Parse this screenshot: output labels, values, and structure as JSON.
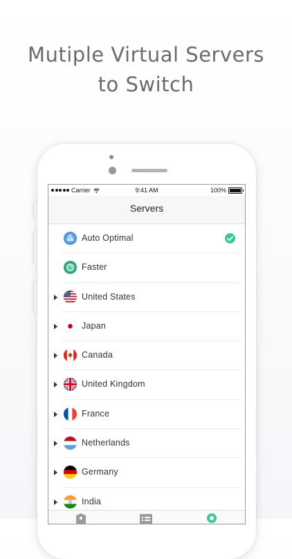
{
  "headline": {
    "line1": "Mutiple Virtual Servers",
    "line2": "to Switch"
  },
  "status_bar": {
    "carrier": "Carrier",
    "time": "9:41 AM",
    "battery": "100%"
  },
  "nav": {
    "title": "Servers"
  },
  "servers": [
    {
      "label": "Auto Optimal",
      "icon": "auto-optimal-icon",
      "expandable": false,
      "selected": true
    },
    {
      "label": "Faster",
      "icon": "faster-icon",
      "expandable": false,
      "selected": false
    },
    {
      "label": "United States",
      "icon": "flag-us",
      "expandable": true,
      "selected": false
    },
    {
      "label": "Japan",
      "icon": "flag-jp",
      "expandable": true,
      "selected": false
    },
    {
      "label": "Canada",
      "icon": "flag-ca",
      "expandable": true,
      "selected": false
    },
    {
      "label": "United Kingdom",
      "icon": "flag-uk",
      "expandable": true,
      "selected": false
    },
    {
      "label": "France",
      "icon": "flag-fr",
      "expandable": true,
      "selected": false
    },
    {
      "label": "Netherlands",
      "icon": "flag-nl",
      "expandable": true,
      "selected": false
    },
    {
      "label": "Germany",
      "icon": "flag-de",
      "expandable": true,
      "selected": false
    },
    {
      "label": "India",
      "icon": "flag-in",
      "expandable": true,
      "selected": false
    }
  ],
  "tabs": [
    {
      "icon": "shield-icon",
      "active": false
    },
    {
      "icon": "list-icon",
      "active": false
    },
    {
      "icon": "location-pin-icon",
      "active": true
    }
  ],
  "colors": {
    "accent": "#3cc79e",
    "headline": "#6b6b6b",
    "text": "#333333"
  }
}
